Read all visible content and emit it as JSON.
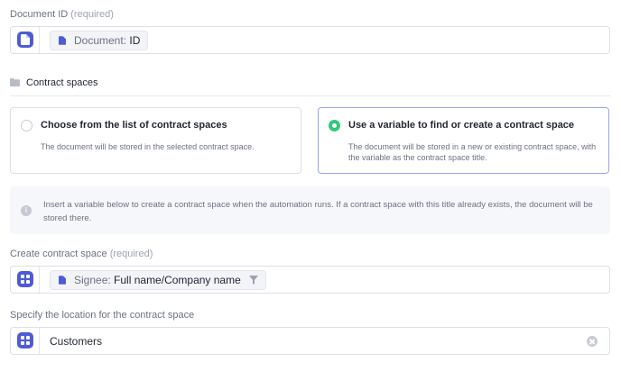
{
  "document_id": {
    "label": "Document ID",
    "required": "(required)",
    "chip_key": "Document:",
    "chip_value": "ID"
  },
  "contract_spaces": {
    "title": "Contract spaces"
  },
  "options": [
    {
      "title": "Choose from the list of contract spaces",
      "description": "The document will be stored in the selected contract space.",
      "selected": false
    },
    {
      "title": "Use a variable to find or create a contract space",
      "description": "The document will be stored in a new or existing contract space, with the variable as the contract space title.",
      "selected": true
    }
  ],
  "info": {
    "text": "Insert a variable below to create a contract space when the automation runs. If a contract space with this title already exists, the document will be stored there."
  },
  "create_space": {
    "label": "Create contract space",
    "required": "(required)",
    "chip_key": "Signee:",
    "chip_value": "Full name/Company name"
  },
  "location": {
    "label": "Specify the location for the contract space",
    "value": "Customers"
  },
  "colors": {
    "accent": "#4f5bd5",
    "selected_radio": "#34c77b"
  }
}
